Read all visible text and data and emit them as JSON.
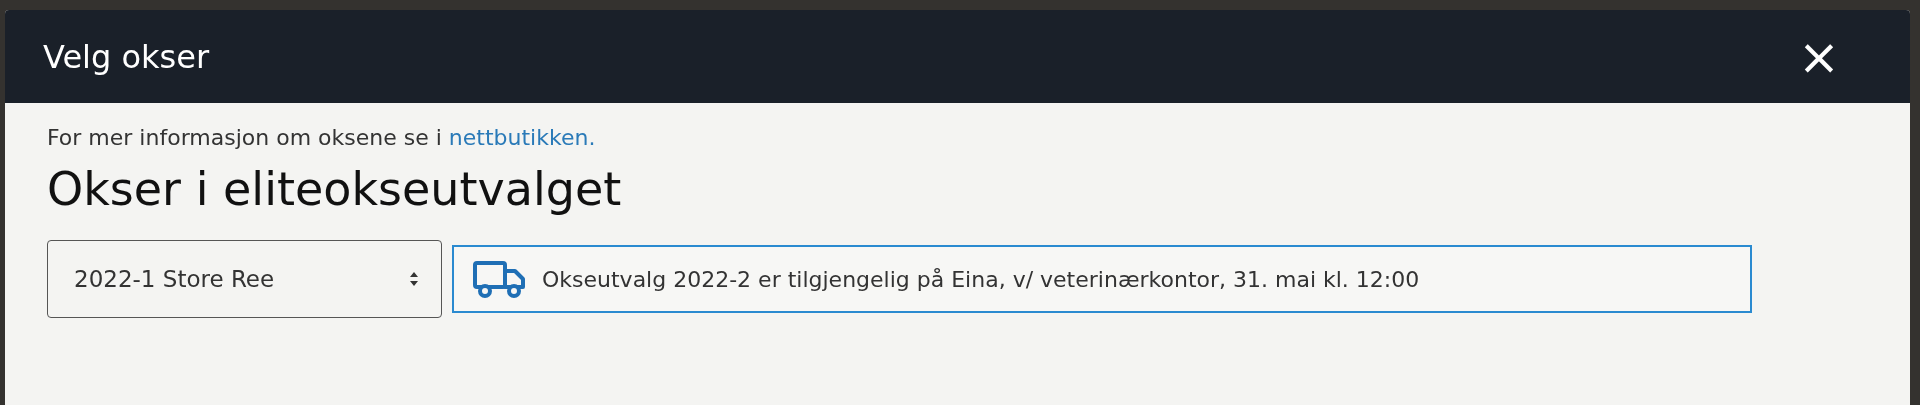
{
  "dialog": {
    "title": "Velg okser",
    "close": "×"
  },
  "info": {
    "text": "For mer informasjon om oksene se i ",
    "link": "nettbutikken."
  },
  "heading": "Okser i eliteokseutvalget",
  "select": {
    "value": "2022-1 Store Ree"
  },
  "notice": {
    "text": "Okseutvalg 2022-2 er tilgjengelig på Eina, v/ veterinærkontor, 31. mai kl. 12:00"
  }
}
